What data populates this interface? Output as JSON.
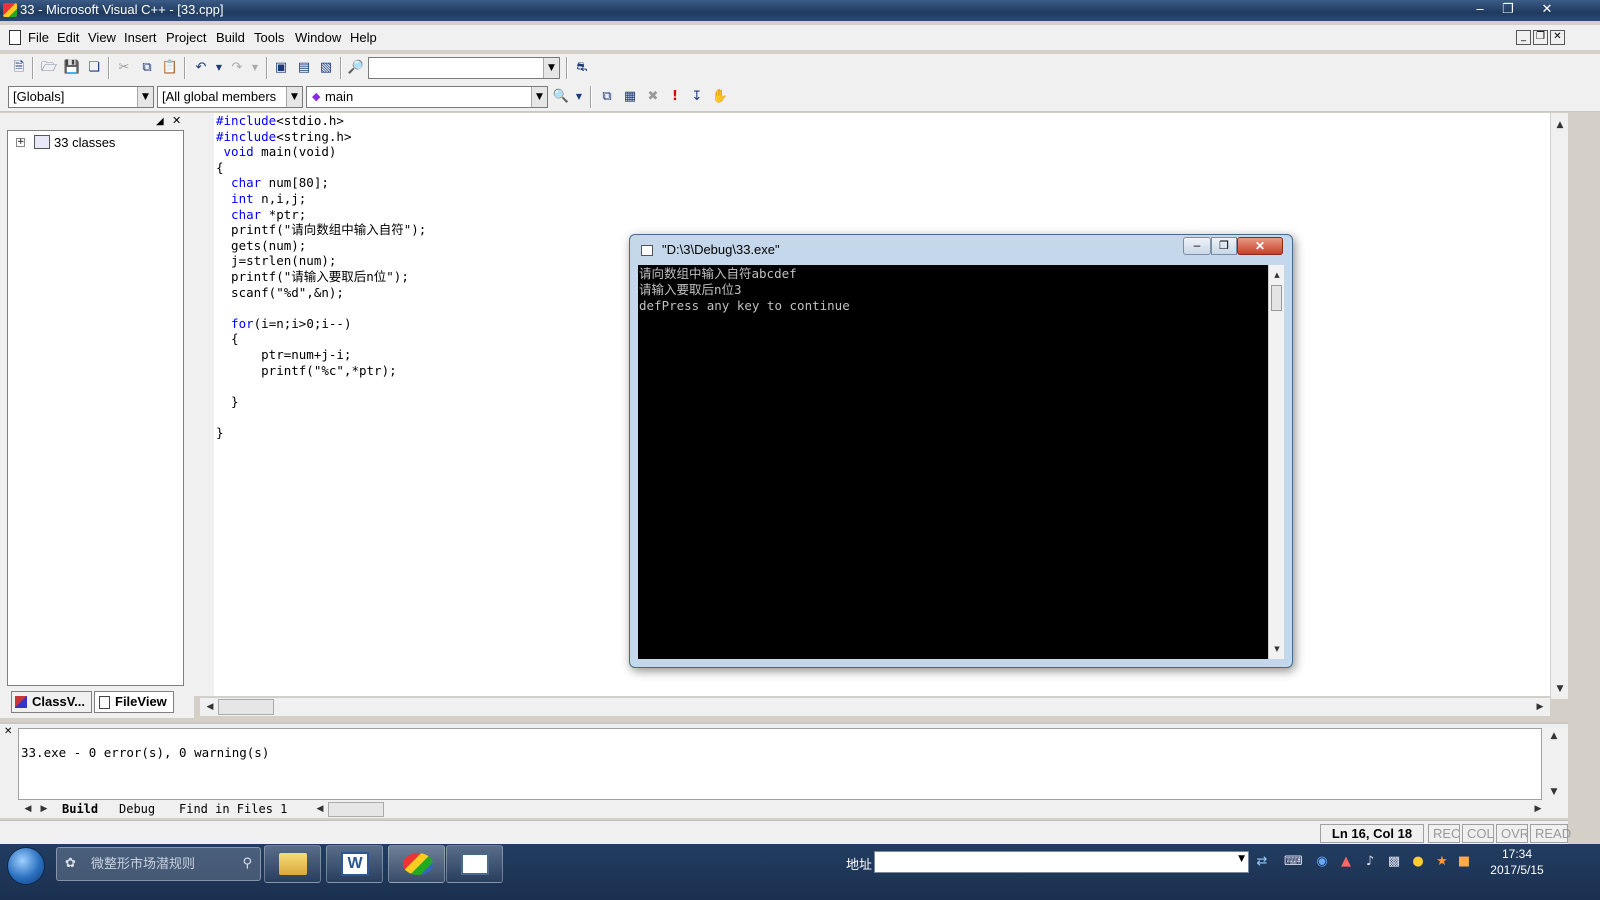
{
  "window": {
    "title": "33 - Microsoft Visual C++ - [33.cpp]"
  },
  "menu": [
    "File",
    "Edit",
    "View",
    "Insert",
    "Project",
    "Build",
    "Tools",
    "Window",
    "Help"
  ],
  "toolbar": {
    "find_combo_value": "",
    "scope_combo": "[Globals]",
    "members_combo": "[All global members",
    "function_combo": "main"
  },
  "workspace": {
    "tree_root": "33 classes",
    "tabs": [
      "ClassV...",
      "FileView"
    ]
  },
  "editor": {
    "lines": [
      {
        "kw": "#include",
        "rest": "<stdio.h>"
      },
      {
        "kw": "#include",
        "rest": "<string.h>"
      },
      {
        "kw": " void",
        "rest": " main(void)"
      },
      {
        "kw": "",
        "rest": "{"
      },
      {
        "kw": "  char",
        "rest": " num[80];"
      },
      {
        "kw": "  int",
        "rest": " n,i,j;"
      },
      {
        "kw": "  char",
        "rest": " *ptr;"
      },
      {
        "kw": "",
        "rest": "  printf(\"请向数组中输入自符\");"
      },
      {
        "kw": "",
        "rest": "  gets(num);"
      },
      {
        "kw": "",
        "rest": "  j=strlen(num);"
      },
      {
        "kw": "",
        "rest": "  printf(\"请输入要取后n位\");"
      },
      {
        "kw": "",
        "rest": "  scanf(\"%d\",&n);"
      },
      {
        "kw": "",
        "rest": ""
      },
      {
        "kw": "  for",
        "rest": "(i=n;i>0;i--)"
      },
      {
        "kw": "",
        "rest": "  {"
      },
      {
        "kw": "",
        "rest": "      ptr=num+j-i;"
      },
      {
        "kw": "",
        "rest": "      printf(\"%c\",*ptr);"
      },
      {
        "kw": "",
        "rest": ""
      },
      {
        "kw": "",
        "rest": "  }"
      },
      {
        "kw": "",
        "rest": ""
      },
      {
        "kw": "",
        "rest": "}"
      }
    ]
  },
  "console": {
    "title": "\"D:\\3\\Debug\\33.exe\"",
    "output": [
      "请向数组中输入自符abcdef",
      "请输入要取后n位3",
      "defPress any key to continue"
    ]
  },
  "output": {
    "message": "33.exe - 0 error(s), 0 warning(s)",
    "tabs": [
      "Build",
      "Debug",
      "Find in Files 1"
    ]
  },
  "status": {
    "position": "Ln 16, Col 18",
    "indicators": [
      "REC",
      "COL",
      "OVR",
      "READ"
    ]
  },
  "taskbar": {
    "search_placeholder": "微整形市场潜规则",
    "address_label": "地址",
    "time": "17:34",
    "date": "2017/5/15"
  }
}
